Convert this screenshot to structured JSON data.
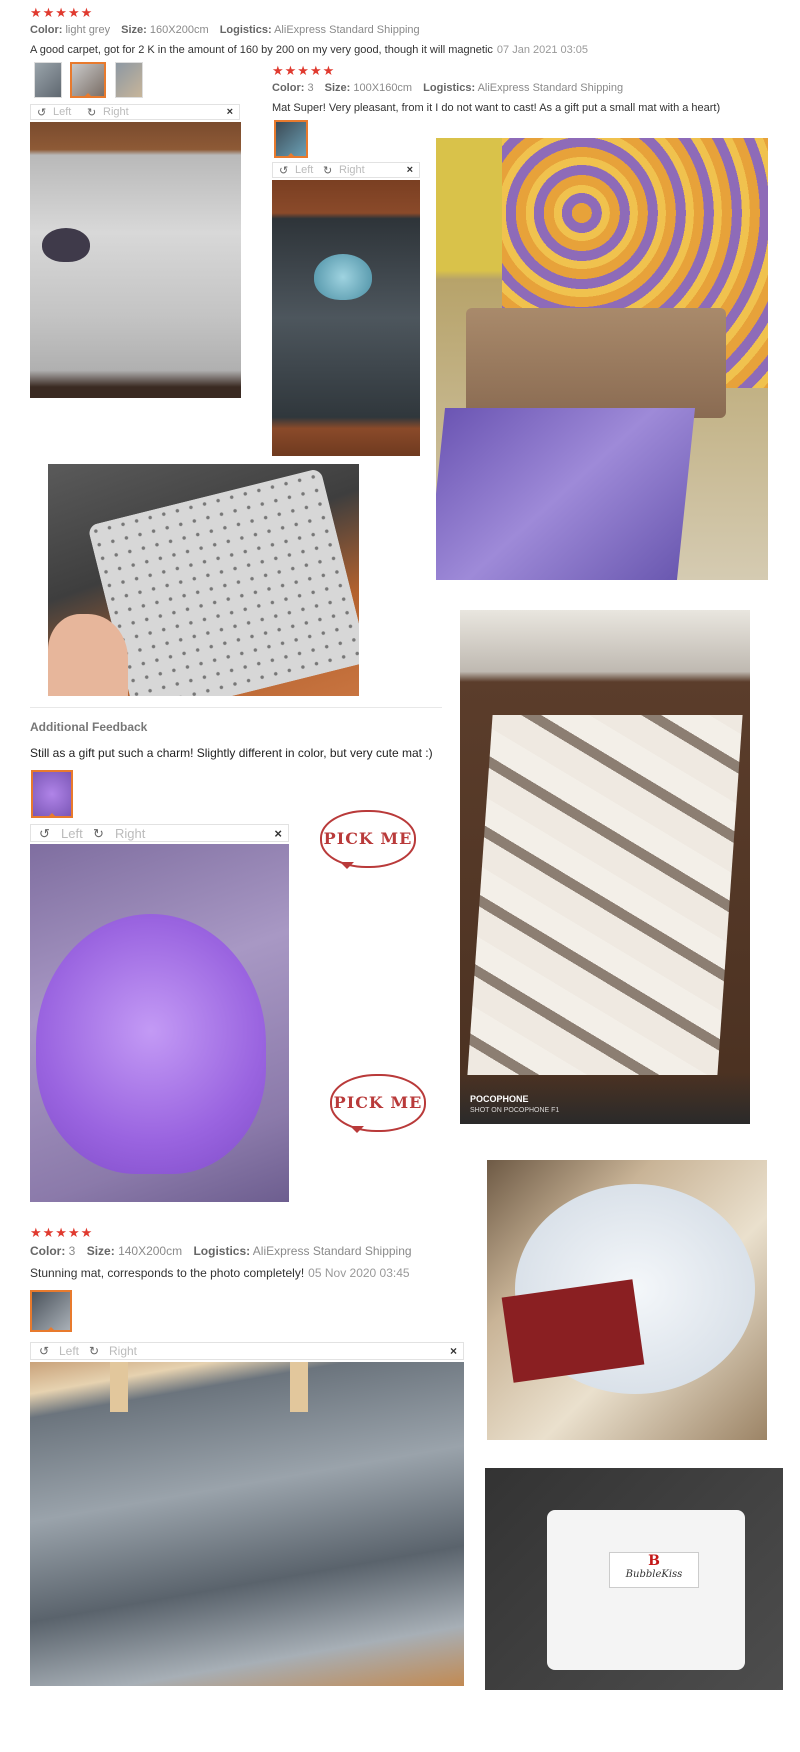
{
  "reviews": [
    {
      "stars": "★★★★★",
      "color_label": "Color:",
      "color": "light grey",
      "size_label": "Size:",
      "size": "160X200cm",
      "logistics_label": "Logistics:",
      "logistics": "AliExpress Standard Shipping",
      "text": "A good carpet, got for 2 K in the amount of 160 by 200 on my very good, though it will magnetic",
      "date": "07 Jan 2021 03:05"
    },
    {
      "stars": "★★★★★",
      "color_label": "Color:",
      "color": "3",
      "size_label": "Size:",
      "size": "100X160cm",
      "logistics_label": "Logistics:",
      "logistics": "AliExpress Standard Shipping",
      "text": "Mat Super! Very pleasant, from it I do not want to cast! As a gift put a small mat with a heart)"
    },
    {
      "stars": "★★★★★",
      "color_label": "Color:",
      "color": "3",
      "size_label": "Size:",
      "size": "140X200cm",
      "logistics_label": "Logistics:",
      "logistics": "AliExpress Standard Shipping",
      "text": "Stunning mat, corresponds to the photo completely!",
      "date": "05 Nov 2020 03:45"
    }
  ],
  "additional": {
    "heading": "Additional Feedback",
    "text": "Still as a gift put such a charm! Slightly different in color, but very cute mat :)"
  },
  "viewer": {
    "left": "Left",
    "right": "Right",
    "close": "×",
    "rotate_left_icon": "↺",
    "rotate_right_icon": "↻"
  },
  "stickers": [
    "PICK ME",
    "PICK ME"
  ],
  "photo_caption": {
    "brand": "POCOPHONE",
    "sub": "SHOT ON POCOPHONE F1"
  },
  "package_label": {
    "brand": "BubbleKiss"
  },
  "colors": {
    "star": "#e03a2f",
    "selected_thumb": "#e87a2d"
  }
}
